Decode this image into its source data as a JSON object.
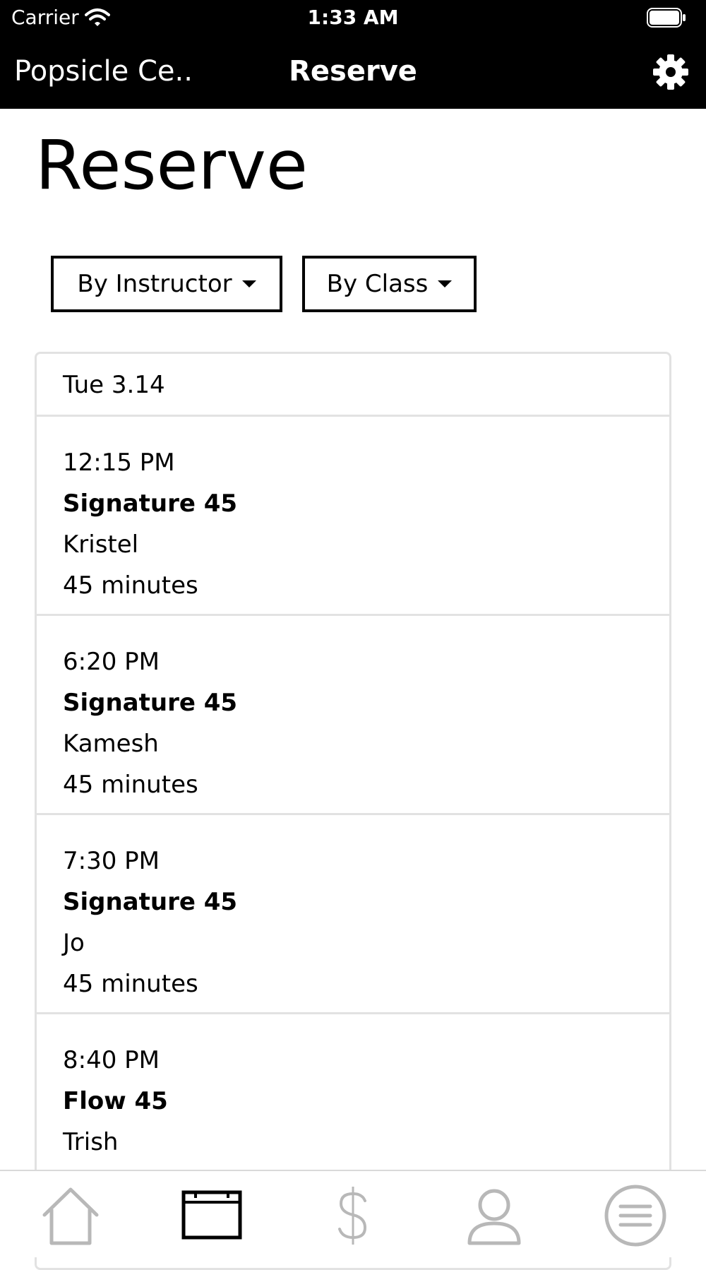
{
  "status_bar": {
    "carrier": "Carrier",
    "time": "1:33 AM"
  },
  "nav": {
    "studio_name": "Popsicle Ce..",
    "title": "Reserve",
    "settings_icon": "gear-icon"
  },
  "page": {
    "heading": "Reserve"
  },
  "filters": {
    "instructor_label": "By Instructor",
    "class_label": "By Class"
  },
  "schedule": {
    "date": "Tue 3.14",
    "sessions": [
      {
        "time": "12:15 PM",
        "class_name": "Signature 45",
        "instructor": "Kristel",
        "duration": "45 minutes"
      },
      {
        "time": "6:20 PM",
        "class_name": "Signature 45",
        "instructor": "Kamesh",
        "duration": "45 minutes"
      },
      {
        "time": "7:30 PM",
        "class_name": "Signature 45",
        "instructor": "Jo",
        "duration": "45 minutes"
      },
      {
        "time": "8:40 PM",
        "class_name": "Flow 45",
        "instructor": "Trish",
        "duration": ""
      }
    ]
  },
  "tabbar": {
    "items": [
      {
        "icon": "home-icon",
        "active": false
      },
      {
        "icon": "calendar-icon",
        "active": true
      },
      {
        "icon": "dollar-icon",
        "active": false
      },
      {
        "icon": "person-icon",
        "active": false
      },
      {
        "icon": "menu-icon",
        "active": false
      }
    ]
  },
  "colors": {
    "header_bg": "#000000",
    "divider": "#e2e2e2",
    "inactive_icon": "#b8b8b8",
    "active_icon": "#000000"
  }
}
